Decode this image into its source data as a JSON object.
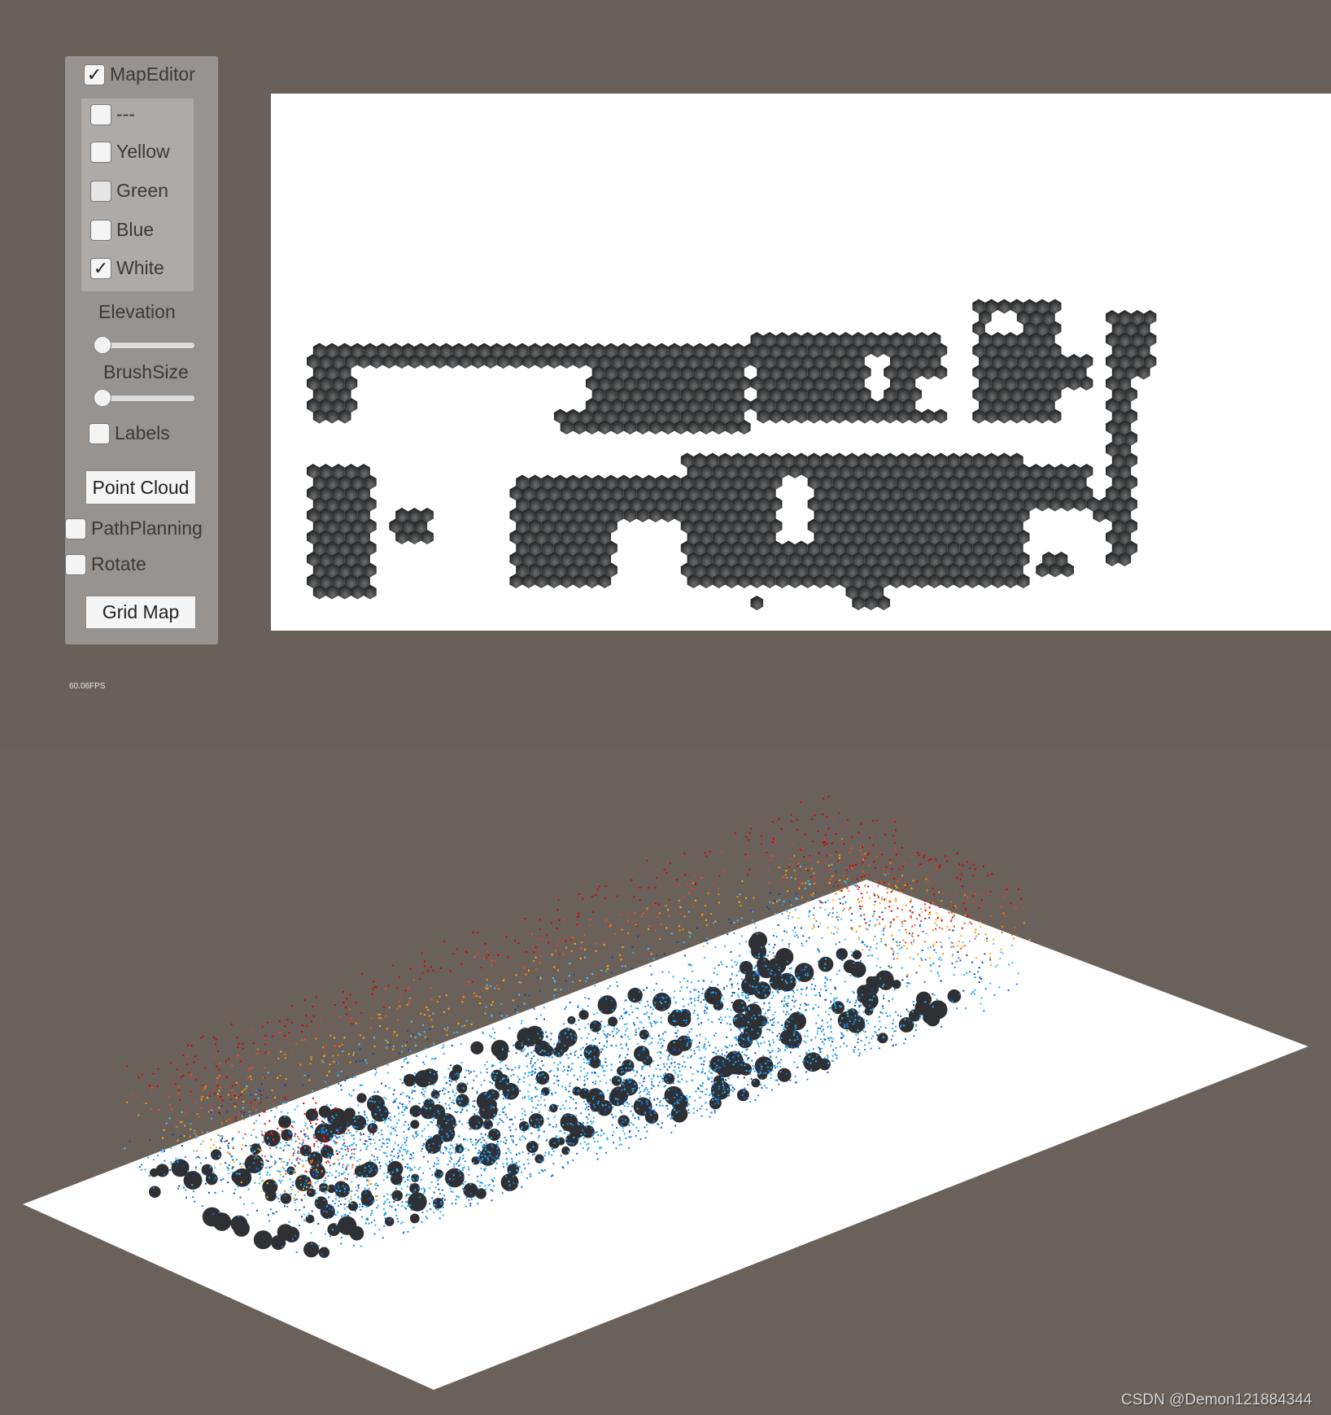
{
  "panel": {
    "map_editor": {
      "label": "MapEditor",
      "checked": true
    },
    "colors": [
      {
        "label": "---",
        "checked": false
      },
      {
        "label": "Yellow",
        "checked": false
      },
      {
        "label": "Green",
        "checked": false
      },
      {
        "label": "Blue",
        "checked": false
      },
      {
        "label": "White",
        "checked": true
      }
    ],
    "elevation": {
      "label": "Elevation",
      "value": 0
    },
    "brush_size": {
      "label": "BrushSize",
      "value": 0
    },
    "labels": {
      "label": "Labels",
      "checked": false
    },
    "point_cloud_button": "Point Cloud",
    "path_planning": {
      "label": "PathPlanning",
      "checked": false
    },
    "rotate": {
      "label": "Rotate",
      "checked": false
    },
    "grid_map_button": "Grid Map"
  },
  "fps": "60.06FPS",
  "watermark": "CSDN @Demon121884344",
  "colors": {
    "background": "#6a605a",
    "panel": "#979390",
    "map_cell_free": "#ffffff",
    "map_cell_occupied": "#2e3033"
  },
  "icons": {
    "checkbox_checked": "check-icon"
  }
}
